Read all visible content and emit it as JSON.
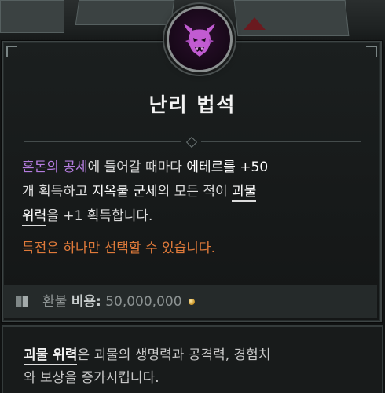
{
  "emblem": {
    "icon": "demon-head-icon",
    "color": "#c15bd1"
  },
  "aspect": {
    "title": "난리 법석",
    "description": {
      "part1_highlight": "혼돈의 공세",
      "part2": "에 들어갈 때마다 ",
      "part3_white": "에테르를 +50",
      "part4": "개 획득하고 ",
      "part5_white": "지옥불 군세",
      "part6": "의 모든 적이 ",
      "part7_underlined": "괴물",
      "part8_underlined": "위력",
      "part9": "을 +1 획득합니다."
    },
    "perk_note": "특전은 하나만 선택할 수 있습니다."
  },
  "cost": {
    "prefix": "환불 ",
    "label": "비용:",
    "value": "50,000,000",
    "currency_icon": "gold-coin-icon",
    "book_icon": "book-icon"
  },
  "info": {
    "term": "괴물 위력",
    "text_after_term": "은 괴물의 생명력과 공격력, 경험치",
    "line2": "와 보상을 증가시킵니다."
  },
  "colors": {
    "highlight_purple": "#b47cde",
    "warning_orange": "#e07a3a",
    "gold": "#c99224"
  }
}
